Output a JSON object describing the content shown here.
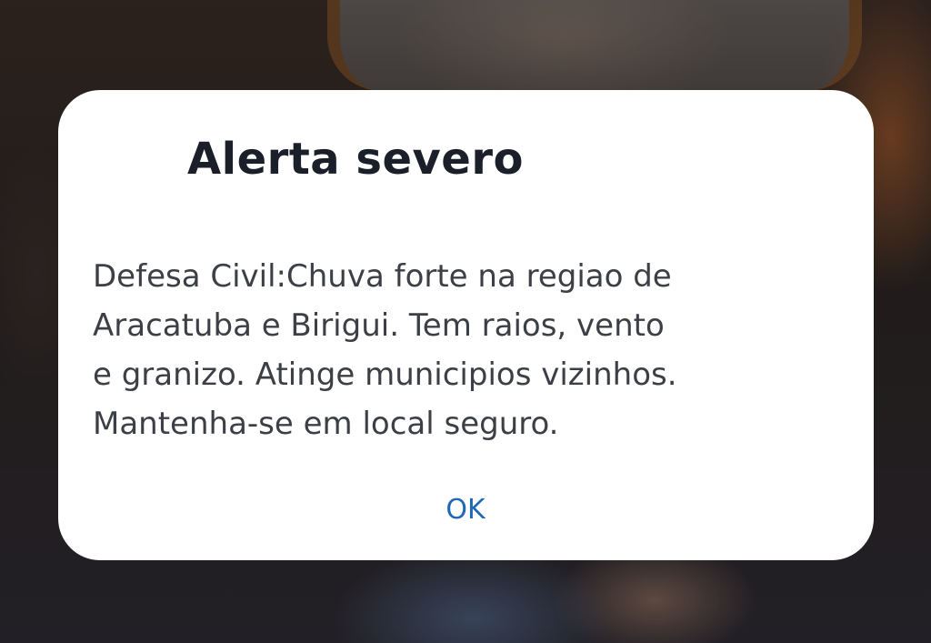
{
  "dialog": {
    "title": "Alerta severo",
    "message_lines": [
      "Defesa Civil:Chuva forte na regiao de",
      "Aracatuba e Birigui. Tem raios, vento",
      "e granizo. Atinge municipios vizinhos.",
      "Mantenha-se em local seguro."
    ],
    "ok_label": "OK"
  },
  "colors": {
    "title": "#1b1f2a",
    "message": "#3c3f45",
    "accent": "#1f68b8",
    "dialog_background": "#ffffff"
  }
}
